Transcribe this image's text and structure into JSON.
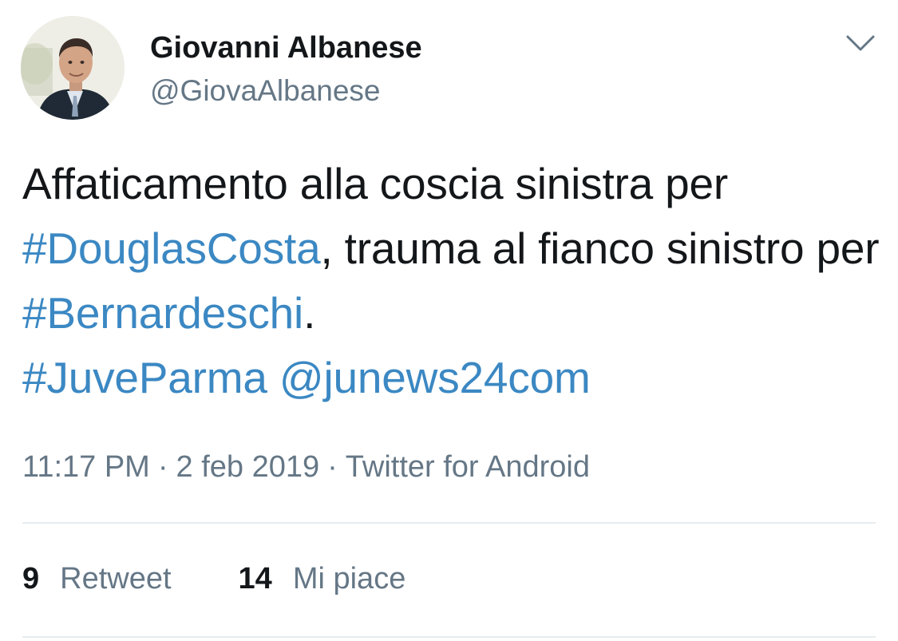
{
  "user": {
    "display_name": "Giovanni Albanese",
    "handle": "@GiovaAlbanese"
  },
  "tweet": {
    "segments": [
      {
        "text": "Affaticamento alla coscia sinistra per ",
        "kind": "text"
      },
      {
        "text": "#DouglasCosta",
        "kind": "hashtag"
      },
      {
        "text": ", trauma al fianco sinistro per ",
        "kind": "text"
      },
      {
        "text": "#Bernardeschi",
        "kind": "hashtag"
      },
      {
        "text": ". ",
        "kind": "text"
      },
      {
        "text": "#JuveParma",
        "kind": "hashtag"
      },
      {
        "text": " ",
        "kind": "text"
      },
      {
        "text": "@junews24com",
        "kind": "mention"
      }
    ]
  },
  "meta": {
    "time": "11:17 PM",
    "date": "2 feb 2019",
    "source": "Twitter for Android",
    "separator": "·"
  },
  "stats": {
    "retweets_count": "9",
    "retweets_label": "Retweet",
    "likes_count": "14",
    "likes_label": "Mi piace"
  },
  "icons": {
    "menu": "chevron-down-icon"
  },
  "colors": {
    "link": "#3b88c3",
    "secondary_text": "#657786",
    "primary_text": "#14171a",
    "divider": "#e6ecf0"
  }
}
